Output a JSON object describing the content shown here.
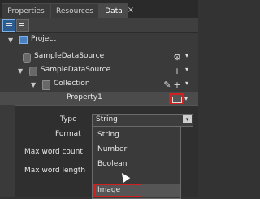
{
  "tabs": [
    {
      "label": "Properties"
    },
    {
      "label": "Resources"
    },
    {
      "label": "Data"
    }
  ],
  "close_glyph": "×",
  "toolbar": {
    "list_view_label": "list-view",
    "details_view_label": "details-view"
  },
  "tree": {
    "project": "Project",
    "data_source_root": "SampleDataSource",
    "data_source_child": "SampleDataSource",
    "collection": "Collection",
    "property": "Property1"
  },
  "glyphs": {
    "expanded": "▼",
    "collapsed_right": "▶",
    "plus": "+",
    "caret": "▾",
    "dropdown": "▾",
    "settings": "⚙",
    "edit": "✎"
  },
  "panel": {
    "type_label": "Type",
    "format_label": "Format",
    "max_word_count_label": "Max word count",
    "max_word_length_label": "Max word length",
    "type_value": "String"
  },
  "dropdown_options": [
    {
      "label": "String"
    },
    {
      "label": "Number"
    },
    {
      "label": "Boolean"
    },
    {
      "label": "Image"
    }
  ],
  "colors": {
    "highlight": "#d02020",
    "accent": "#2c5b8f"
  }
}
